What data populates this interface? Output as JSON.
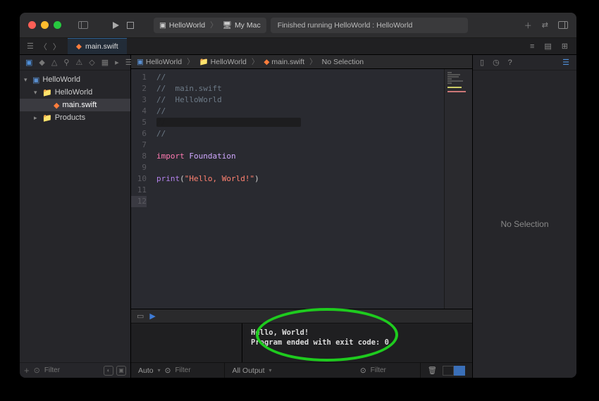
{
  "titlebar": {
    "scheme_project": "HelloWorld",
    "scheme_destination": "My Mac",
    "status": "Finished running HelloWorld : HelloWorld"
  },
  "tab": {
    "filename": "main.swift"
  },
  "navigator": {
    "project": "HelloWorld",
    "target_folder": "HelloWorld",
    "file": "main.swift",
    "products": "Products",
    "filter_placeholder": "Filter"
  },
  "jumpbar": {
    "c0": "HelloWorld",
    "c1": "HelloWorld",
    "c2": "main.swift",
    "c3": "No Selection"
  },
  "code": {
    "lines": [
      "1",
      "2",
      "3",
      "4",
      "5",
      "6",
      "7",
      "8",
      "9",
      "10",
      "11",
      "12"
    ],
    "l1": "//",
    "l2": "//  main.swift",
    "l3": "//  HelloWorld",
    "l4": "//",
    "l5_redacted": "//                             ",
    "l6": "//",
    "l7": "",
    "l8_kw": "import",
    "l8_type": " Foundation",
    "l9": "",
    "l10_func": "print",
    "l10_paren_open": "(",
    "l10_str": "\"Hello, World!\"",
    "l10_paren_close": ")",
    "l11": "",
    "l12": ""
  },
  "console": {
    "line1": "Hello, World!",
    "line2": "Program ended with exit code: 0"
  },
  "debug_footer": {
    "auto": "Auto",
    "filter_placeholder": "Filter",
    "all_output": "All Output"
  },
  "inspector": {
    "empty": "No Selection"
  }
}
